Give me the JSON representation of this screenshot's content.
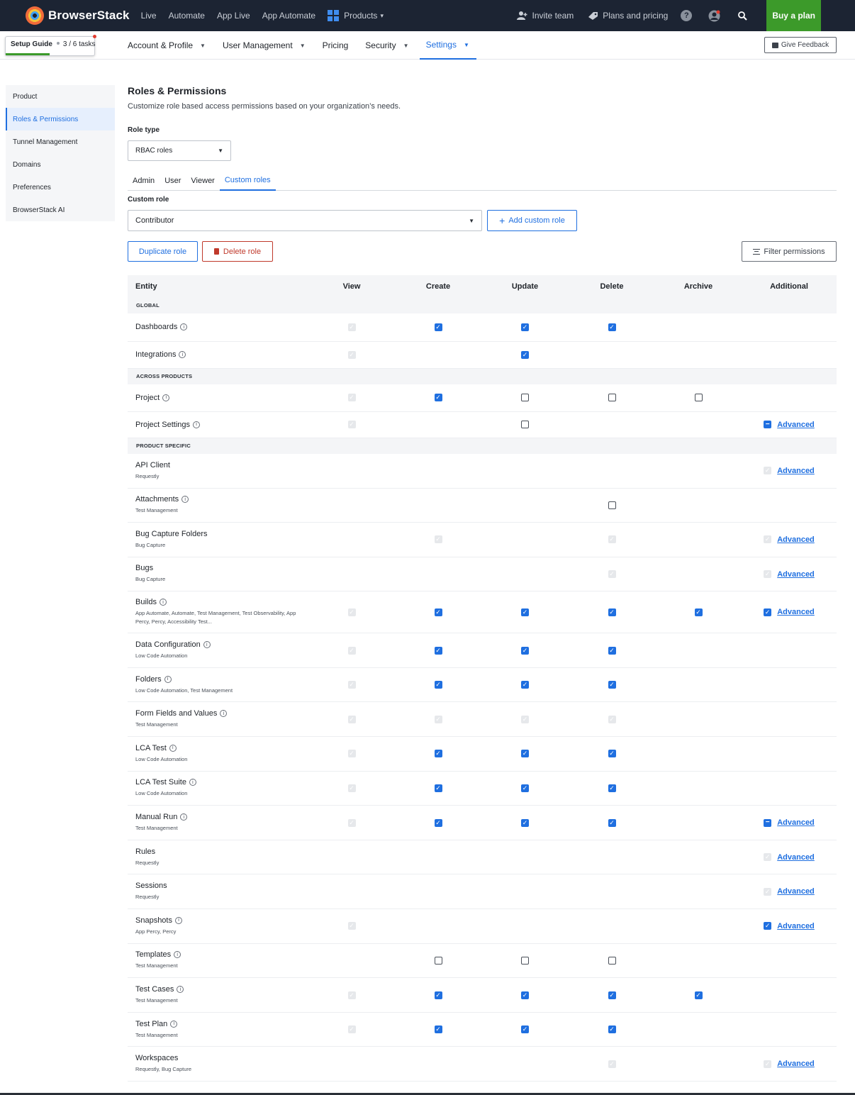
{
  "topbar": {
    "brand": "BrowserStack",
    "nav": [
      "Live",
      "Automate",
      "App Live",
      "App Automate"
    ],
    "products": "Products",
    "invite": "Invite team",
    "plans": "Plans and pricing",
    "help": "?",
    "buy": "Buy a plan"
  },
  "subnav": {
    "setup_guide": "Setup Guide",
    "setup_tasks": "3 / 6 tasks",
    "setup_progress": 0.5,
    "tabs": [
      {
        "label": "Account & Profile",
        "dropdown": true
      },
      {
        "label": "User Management",
        "dropdown": true
      },
      {
        "label": "Pricing",
        "dropdown": false
      },
      {
        "label": "Security",
        "dropdown": true
      },
      {
        "label": "Settings",
        "dropdown": true,
        "active": true
      }
    ],
    "feedback": "Give Feedback"
  },
  "sidebar": {
    "items": [
      {
        "label": "Product"
      },
      {
        "label": "Roles & Permissions",
        "active": true
      },
      {
        "label": "Tunnel Management"
      },
      {
        "label": "Domains"
      },
      {
        "label": "Preferences"
      },
      {
        "label": "BrowserStack AI"
      }
    ]
  },
  "main": {
    "title": "Roles & Permissions",
    "subtitle": "Customize role based access permissions based on your organization’s needs.",
    "role_type_label": "Role type",
    "role_type_value": "RBAC roles",
    "tabs": [
      {
        "label": "Admin"
      },
      {
        "label": "User"
      },
      {
        "label": "Viewer"
      },
      {
        "label": "Custom roles",
        "active": true
      }
    ],
    "custom_role_label": "Custom role",
    "custom_role_value": "Contributor",
    "add_custom_role": "Add custom role",
    "duplicate_role": "Duplicate role",
    "delete_role": "Delete role",
    "filter_permissions": "Filter permissions"
  },
  "table": {
    "columns": [
      "Entity",
      "View",
      "Create",
      "Update",
      "Delete",
      "Archive",
      "Additional"
    ],
    "advanced_label": "Advanced",
    "legend": {
      "c": "checked",
      "u": "unchecked",
      "d": "disabled",
      "i": "indeterminate",
      "-": "none"
    },
    "sections": [
      {
        "title": "GLOBAL",
        "rows": [
          {
            "name": "Dashboards",
            "info": true,
            "sub": "",
            "cells": [
              "d",
              "c",
              "c",
              "c",
              "-",
              "-"
            ]
          },
          {
            "name": "Integrations",
            "info": true,
            "sub": "",
            "cells": [
              "d",
              "-",
              "c",
              "-",
              "-",
              "-"
            ]
          }
        ]
      },
      {
        "title": "ACROSS PRODUCTS",
        "rows": [
          {
            "name": "Project",
            "info": true,
            "sub": "",
            "cells": [
              "d",
              "c",
              "u",
              "u",
              "u",
              "-"
            ]
          },
          {
            "name": "Project Settings",
            "info": true,
            "sub": "",
            "cells": [
              "d",
              "-",
              "u",
              "-",
              "-",
              "i"
            ]
          }
        ]
      },
      {
        "title": "PRODUCT SPECIFIC",
        "rows": [
          {
            "name": "API Client",
            "info": false,
            "sub": "Requestly",
            "cells": [
              "-",
              "-",
              "-",
              "-",
              "-",
              "d"
            ]
          },
          {
            "name": "Attachments",
            "info": true,
            "sub": "Test Management",
            "cells": [
              "-",
              "-",
              "-",
              "u",
              "-",
              "-"
            ]
          },
          {
            "name": "Bug Capture Folders",
            "info": false,
            "sub": "Bug Capture",
            "cells": [
              "-",
              "d",
              "-",
              "d",
              "-",
              "d"
            ]
          },
          {
            "name": "Bugs",
            "info": false,
            "sub": "Bug Capture",
            "cells": [
              "-",
              "-",
              "-",
              "d",
              "-",
              "d"
            ]
          },
          {
            "name": "Builds",
            "info": true,
            "sub": "App Automate, Automate, Test Management, Test Observability, App Percy, Percy, Accessibility Test...",
            "cells": [
              "d",
              "c",
              "c",
              "c",
              "c",
              "c"
            ]
          },
          {
            "name": "Data Configuration",
            "info": true,
            "sub": "Low Code Automation",
            "cells": [
              "d",
              "c",
              "c",
              "c",
              "-",
              "-"
            ]
          },
          {
            "name": "Folders",
            "info": true,
            "sub": "Low Code Automation, Test Management",
            "cells": [
              "d",
              "c",
              "c",
              "c",
              "-",
              "-"
            ]
          },
          {
            "name": "Form Fields and Values",
            "info": true,
            "sub": "Test Management",
            "cells": [
              "d",
              "d",
              "d",
              "d",
              "-",
              "-"
            ]
          },
          {
            "name": "LCA Test",
            "info": true,
            "sub": "Low Code Automation",
            "cells": [
              "d",
              "c",
              "c",
              "c",
              "-",
              "-"
            ]
          },
          {
            "name": "LCA Test Suite",
            "info": true,
            "sub": "Low Code Automation",
            "cells": [
              "d",
              "c",
              "c",
              "c",
              "-",
              "-"
            ]
          },
          {
            "name": "Manual Run",
            "info": true,
            "sub": "Test Management",
            "cells": [
              "d",
              "c",
              "c",
              "c",
              "-",
              "i"
            ]
          },
          {
            "name": "Rules",
            "info": false,
            "sub": "Requestly",
            "cells": [
              "-",
              "-",
              "-",
              "-",
              "-",
              "d"
            ]
          },
          {
            "name": "Sessions",
            "info": false,
            "sub": "Requestly",
            "cells": [
              "-",
              "-",
              "-",
              "-",
              "-",
              "d"
            ]
          },
          {
            "name": "Snapshots",
            "info": true,
            "sub": "App Percy, Percy",
            "cells": [
              "d",
              "-",
              "-",
              "-",
              "-",
              "c"
            ]
          },
          {
            "name": "Templates",
            "info": true,
            "sub": "Test Management",
            "cells": [
              "-",
              "u",
              "u",
              "u",
              "-",
              "-"
            ]
          },
          {
            "name": "Test Cases",
            "info": true,
            "sub": "Test Management",
            "cells": [
              "d",
              "c",
              "c",
              "c",
              "c",
              "-"
            ]
          },
          {
            "name": "Test Plan",
            "info": true,
            "sub": "Test Management",
            "cells": [
              "d",
              "c",
              "c",
              "c",
              "-",
              "-"
            ]
          },
          {
            "name": "Workspaces",
            "info": false,
            "sub": "Requestly, Bug Capture",
            "cells": [
              "-",
              "-",
              "-",
              "d",
              "-",
              "d"
            ]
          }
        ]
      }
    ]
  }
}
